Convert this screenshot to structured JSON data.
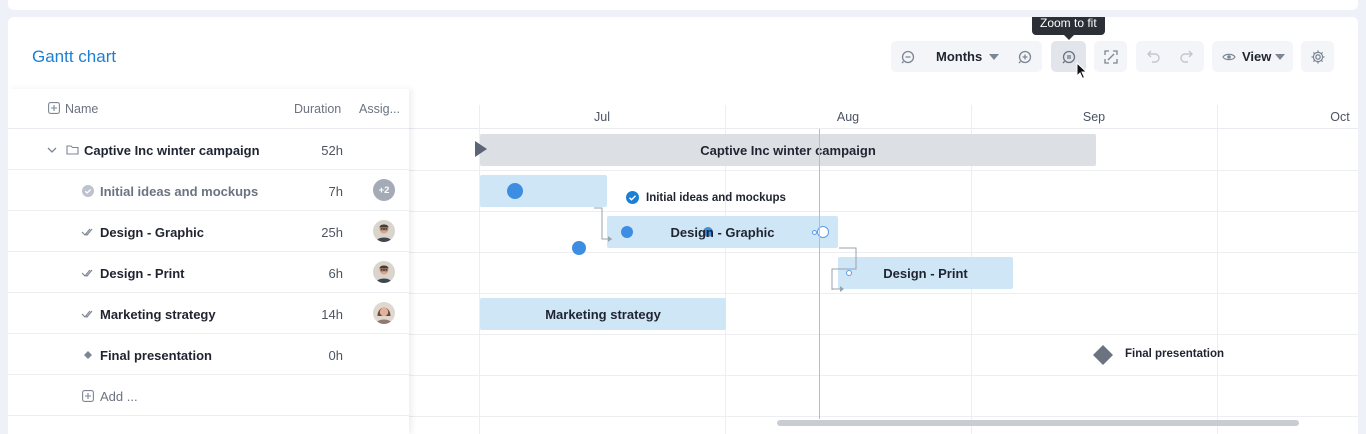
{
  "header": {
    "title": "Gantt chart"
  },
  "toolbar": {
    "zoom_unit": "Months",
    "view_label": "View",
    "tooltip": "Zoom to fit"
  },
  "grid": {
    "columns": {
      "name": "Name",
      "duration": "Duration",
      "assignee": "Assig..."
    },
    "rows": [
      {
        "name": "Captive Inc winter campaign",
        "duration": "52h"
      },
      {
        "name": "Initial ideas and mockups",
        "duration": "7h",
        "extra_assignees": "+2"
      },
      {
        "name": "Design - Graphic",
        "duration": "25h"
      },
      {
        "name": "Design - Print",
        "duration": "6h"
      },
      {
        "name": "Marketing strategy",
        "duration": "14h"
      },
      {
        "name": "Final presentation",
        "duration": "0h"
      }
    ],
    "add_label": "Add ..."
  },
  "timeline": {
    "months": [
      "Jul",
      "Aug",
      "Sep",
      "Oct"
    ],
    "bars": {
      "summary": "Captive Inc winter campaign",
      "initial": "Initial ideas and mockups",
      "graphic": "Design - Graphic",
      "print": "Design - Print",
      "marketing": "Marketing strategy",
      "milestone": "Final presentation"
    }
  },
  "colors": {
    "accent": "#1b7fd6",
    "task_bar": "#cfe6f7",
    "summary_bar": "#dcdfe4",
    "today_line": "#f0a5ab"
  }
}
